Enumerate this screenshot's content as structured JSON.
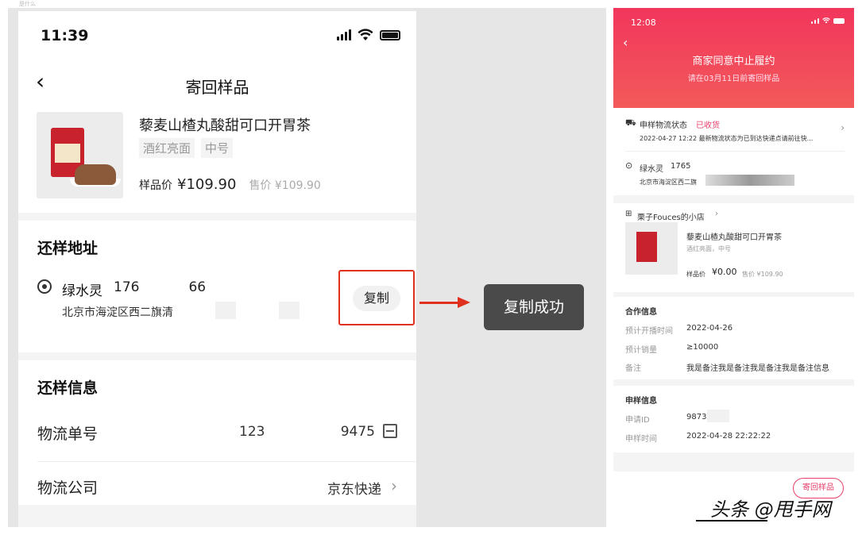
{
  "corner_text": "是什么",
  "left_phone": {
    "status": {
      "time": "11:39"
    },
    "nav": {
      "title": "寄回样品"
    },
    "product": {
      "title": "藜麦山楂丸酸甜可口开胃茶",
      "tags": [
        "酒红亮面",
        "中号"
      ],
      "price_label": "样品价",
      "price_value": "¥109.90",
      "sale_label": "售价 ¥109.90"
    },
    "address": {
      "title": "还样地址",
      "name": "绿水灵",
      "phone_start": "176",
      "phone_end": "66",
      "detail": "北京市海淀区西二旗清",
      "copy_label": "复制"
    },
    "info": {
      "title": "还样信息",
      "rows": [
        {
          "label": "物流单号",
          "value_start": "123",
          "value_end": "9475"
        },
        {
          "label": "物流公司",
          "value": "京东快递"
        }
      ]
    }
  },
  "toast": {
    "text": "复制成功"
  },
  "right_phone": {
    "status": {
      "time": "12:08"
    },
    "header": {
      "title": "商家同意中止履约",
      "subtitle": "请在03月11日前寄回样品"
    },
    "logistics": {
      "label": "申样物流状态",
      "status": "已收货",
      "detail": "2022-04-27 12:22 最新物流状态为已到达快递点请前往快..."
    },
    "address": {
      "name": "绿水灵",
      "phone": "1765",
      "detail": "北京市海淀区西二旗"
    },
    "shop": {
      "name": "栗子Fouces的小店",
      "product_title": "藜麦山楂丸酸甜可口开胃茶",
      "product_sku": "酒红亮面，中号",
      "price_label": "样品价",
      "price_value": "¥0.00",
      "sale_label": "售价 ¥109.90"
    },
    "cooperation": {
      "title": "合作信息",
      "rows": [
        {
          "label": "预计开播时间",
          "value": "2022-04-26"
        },
        {
          "label": "预计销量",
          "value": "≥10000"
        },
        {
          "label": "备注",
          "value": "我是备注我是备注我是备注我是备注信息"
        }
      ]
    },
    "apply": {
      "title": "申样信息",
      "rows": [
        {
          "label": "申请ID",
          "value": "9873"
        },
        {
          "label": "申样时间",
          "value": "2022-04-28 22:22:22"
        }
      ]
    },
    "button": "寄回样品"
  },
  "watermark": "头条 @甩手网",
  "colors": {
    "accent_red": "#e0301e",
    "brand_pink": "#f2365c",
    "toast_bg": "#4a4a4a"
  }
}
